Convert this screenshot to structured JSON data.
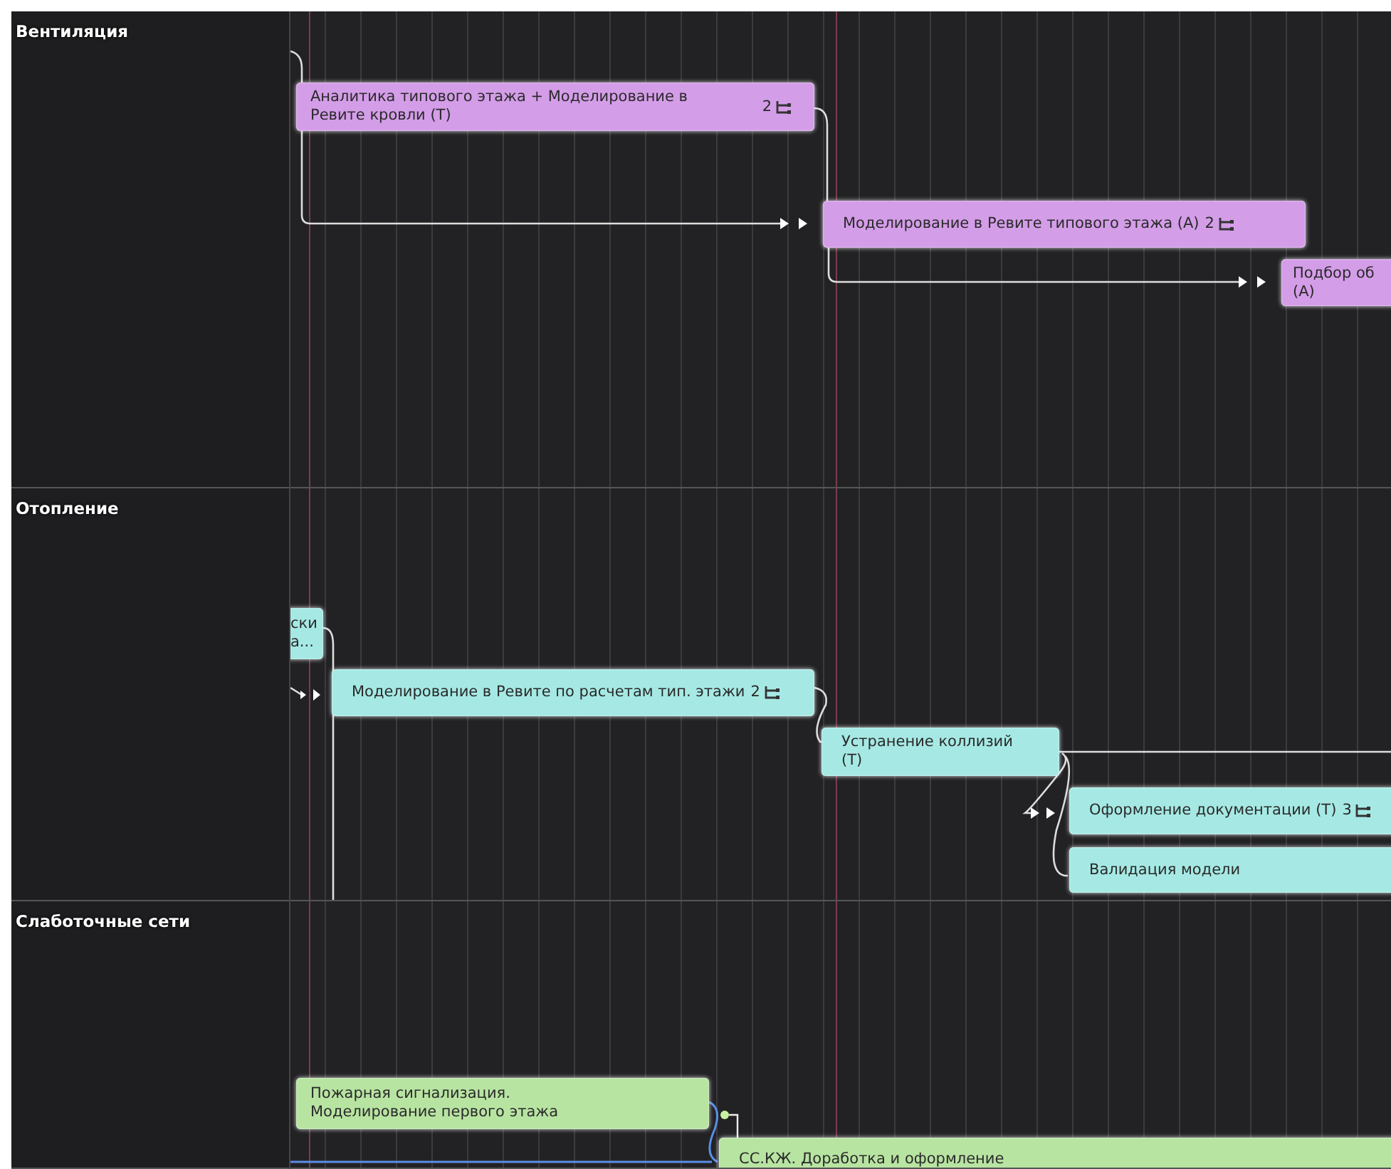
{
  "lanes": [
    {
      "name": "Вентиляция",
      "color": "#d49de8",
      "tasks": [
        {
          "title": "Аналитика типового этажа + Моделирование в Ревите кровли (Т)",
          "subtasks": "2"
        },
        {
          "title": "Моделирование в Ревите типового этажа (А)",
          "subtasks": "2"
        },
        {
          "title": "Подбор об\n(А)"
        }
      ]
    },
    {
      "name": "Отопление",
      "color": "#a6e9e4",
      "tasks": [
        {
          "title": "ски\nа..."
        },
        {
          "title": "Моделирование в Ревите по расчетам тип. этажи",
          "subtasks": "2"
        },
        {
          "title": "Устранение коллизий (Т)"
        },
        {
          "title": "Оформление документации (Т)",
          "subtasks": "3"
        },
        {
          "title": "Валидация модели"
        }
      ]
    },
    {
      "name": "Слаботочные сети",
      "color": "#b8e4a2",
      "tasks": [
        {
          "title": "Пожарная сигнализация. Моделирование первого этажа"
        },
        {
          "title": "СС.КЖ. Доработка и оформление"
        }
      ]
    }
  ]
}
